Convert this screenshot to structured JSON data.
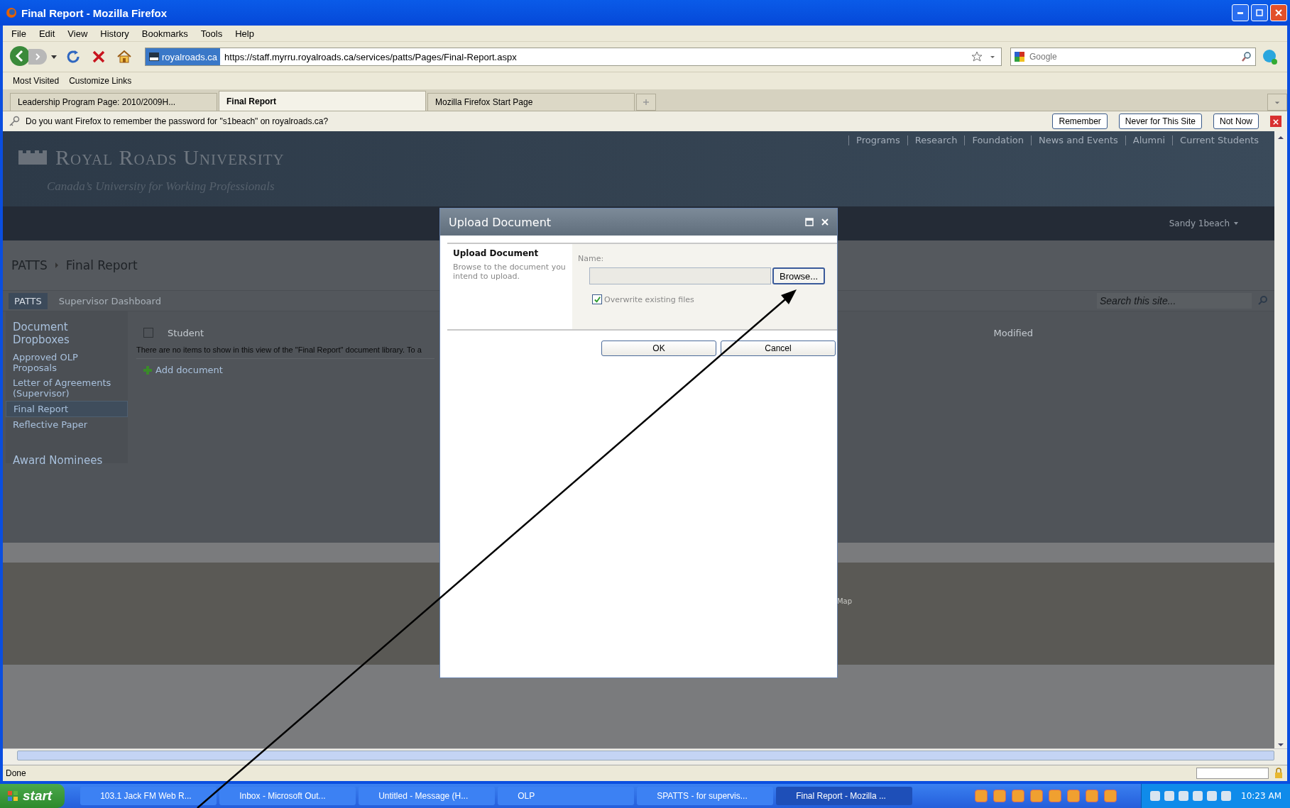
{
  "window": {
    "title": "Final Report - Mozilla Firefox"
  },
  "menu": [
    "File",
    "Edit",
    "View",
    "History",
    "Bookmarks",
    "Tools",
    "Help"
  ],
  "address": {
    "site": "royalroads.ca",
    "url": "https://staff.myrru.royalroads.ca/services/patts/Pages/Final-Report.aspx"
  },
  "search": {
    "placeholder": "Google"
  },
  "bookmarks": [
    "Most Visited",
    "Customize Links"
  ],
  "tabs": [
    {
      "label": "Leadership Program Page: 2010/2009H...",
      "selected": false
    },
    {
      "label": "Final Report",
      "selected": true
    },
    {
      "label": "Mozilla Firefox Start Page",
      "selected": false
    }
  ],
  "password_bar": {
    "message": "Do you want Firefox to remember the password for \"s1beach\" on royalroads.ca?",
    "buttons": [
      "Remember",
      "Never for This Site",
      "Not Now"
    ]
  },
  "site": {
    "name": "Royal Roads University",
    "tagline": "Canada’s University for Working Professionals",
    "top_links": [
      "Programs",
      "Research",
      "Foundation",
      "News and Events",
      "Alumni",
      "Current Students"
    ],
    "user": "Sandy 1beach",
    "breadcrumb": [
      "PATTS",
      "Final Report"
    ],
    "nav_tabs": [
      {
        "label": "PATTS",
        "selected": true
      },
      {
        "label": "Supervisor Dashboard",
        "selected": false
      }
    ],
    "search_placeholder": "Search this site...",
    "quick_launch": [
      {
        "label": "Document Dropboxes",
        "kind": "heading",
        "selected": false
      },
      {
        "label": "Approved OLP Proposals",
        "kind": "link",
        "selected": false
      },
      {
        "label": "Letter of Agreements (Supervisor)",
        "kind": "link",
        "selected": false
      },
      {
        "label": "Final Report",
        "kind": "link",
        "selected": true
      },
      {
        "label": "Reflective Paper",
        "kind": "link",
        "selected": false
      },
      {
        "label": "Award Nominees",
        "kind": "heading",
        "selected": false
      }
    ],
    "columns": [
      "Student",
      "Modified"
    ],
    "select_all_checked": false,
    "empty_message": "There are no items to show in this view of the \"Final Report\" document library. To a",
    "add_link": "Add document",
    "footer_fragment": "Map"
  },
  "dialog": {
    "title": "Upload Document",
    "section_title": "Upload Document",
    "section_help": "Browse to the document you intend to upload.",
    "name_label": "Name:",
    "browse": "Browse...",
    "overwrite": {
      "label": "Overwrite existing files",
      "checked": true
    },
    "buttons": [
      "OK",
      "Cancel"
    ]
  },
  "status_bar": {
    "text": "Done"
  },
  "taskbar": {
    "start": "start",
    "items": [
      {
        "label": "103.1 Jack FM Web R...",
        "selected": false
      },
      {
        "label": "Inbox - Microsoft Out...",
        "selected": false
      },
      {
        "label": "Untitled - Message (H...",
        "selected": false
      },
      {
        "label": "OLP",
        "selected": false
      },
      {
        "label": "SPATTS - for supervis...",
        "selected": false
      },
      {
        "label": "Final Report - Mozilla ...",
        "selected": true
      }
    ],
    "clock": "10:23 AM"
  }
}
